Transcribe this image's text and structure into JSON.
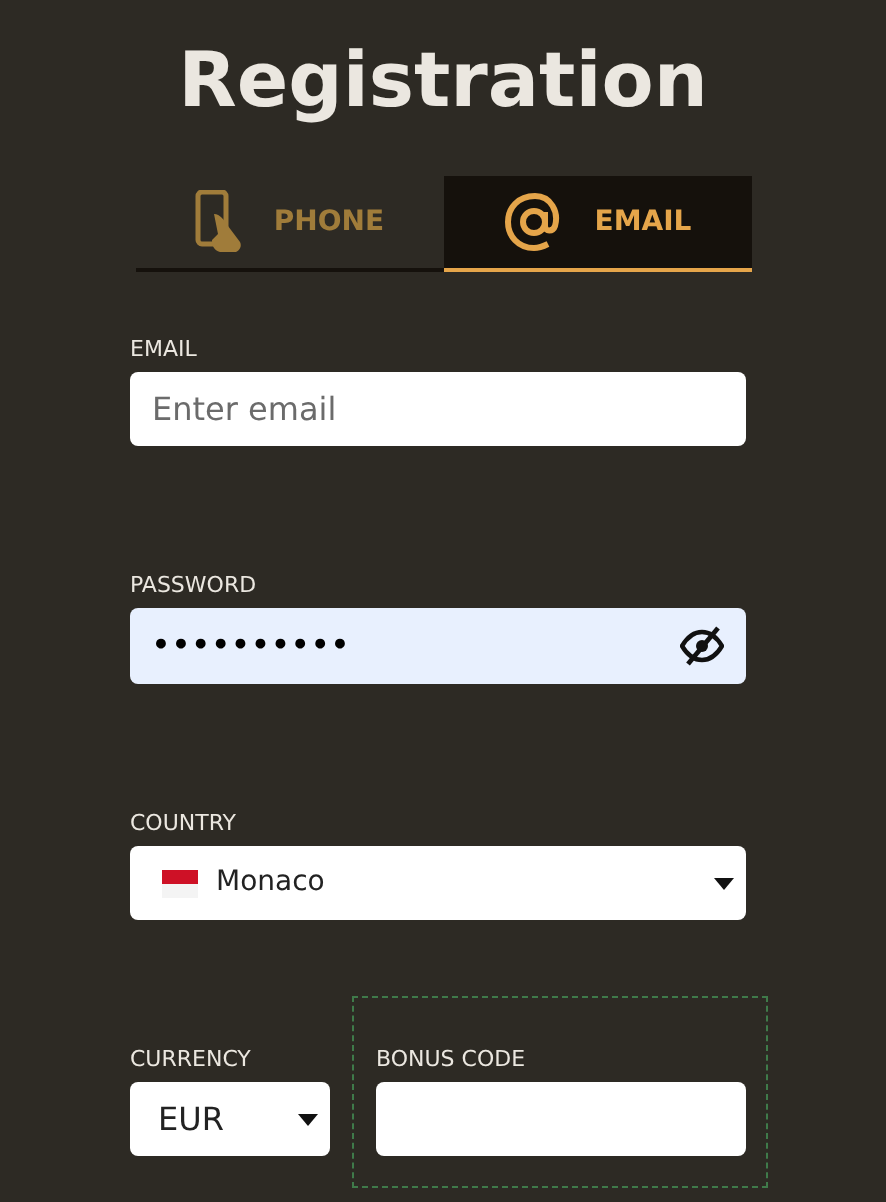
{
  "title": "Registration",
  "tabs": [
    {
      "label": "PHONE",
      "kind": "phone",
      "selected": false
    },
    {
      "label": "EMAIL",
      "kind": "email",
      "selected": true
    }
  ],
  "email": {
    "label": "EMAIL",
    "placeholder": "Enter email"
  },
  "password": {
    "label": "PASSWORD",
    "value": "••••••••••",
    "visible": false
  },
  "country": {
    "label": "COUNTRY",
    "value": "Monaco"
  },
  "currency": {
    "label": "CURRENCY",
    "value": "EUR"
  },
  "bonus_code": {
    "label": "BONUS CODE"
  }
}
